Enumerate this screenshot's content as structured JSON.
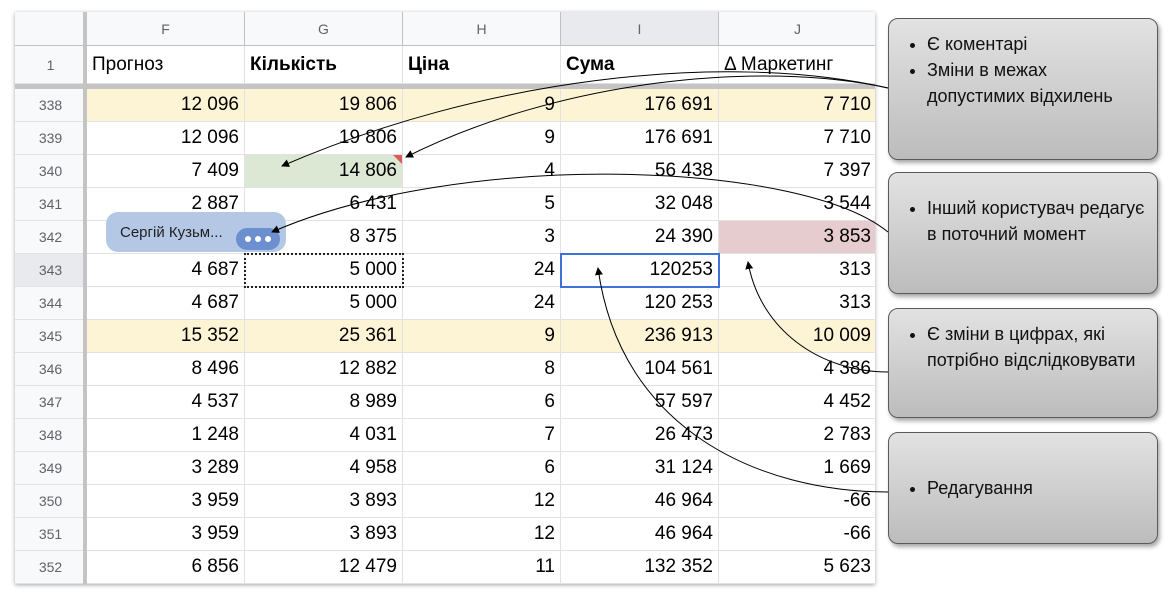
{
  "sheet": {
    "columns": [
      "F",
      "G",
      "H",
      "I",
      "J"
    ],
    "header_row": {
      "number": "1",
      "cells": [
        "Прогноз",
        "Кількість",
        "Ціна",
        "Сума",
        "Δ Маркетинг"
      ]
    },
    "rows": [
      {
        "n": "338",
        "cells": [
          "12 096",
          "19 806",
          "9",
          "176 691",
          "7 710"
        ]
      },
      {
        "n": "339",
        "cells": [
          "12 096",
          "19 806",
          "9",
          "176 691",
          "7 710"
        ]
      },
      {
        "n": "340",
        "cells": [
          "7 409",
          "14 806",
          "4",
          "56 438",
          "7 397"
        ]
      },
      {
        "n": "341",
        "cells": [
          "2 887",
          "6 431",
          "5",
          "32 048",
          "3 544"
        ]
      },
      {
        "n": "342",
        "cells": [
          "",
          "8 375",
          "3",
          "24 390",
          "3 853"
        ]
      },
      {
        "n": "343",
        "cells": [
          "4 687",
          "5 000",
          "24",
          "120253",
          "313"
        ]
      },
      {
        "n": "344",
        "cells": [
          "4 687",
          "5 000",
          "24",
          "120 253",
          "313"
        ]
      },
      {
        "n": "345",
        "cells": [
          "15 352",
          "25 361",
          "9",
          "236 913",
          "10 009"
        ]
      },
      {
        "n": "346",
        "cells": [
          "8 496",
          "12 882",
          "8",
          "104 561",
          "4 386"
        ]
      },
      {
        "n": "347",
        "cells": [
          "4 537",
          "8 989",
          "6",
          "57 597",
          "4 452"
        ]
      },
      {
        "n": "348",
        "cells": [
          "1 248",
          "4 031",
          "7",
          "26 473",
          "2 783"
        ]
      },
      {
        "n": "349",
        "cells": [
          "3 289",
          "4 958",
          "6",
          "31 124",
          "1 669"
        ]
      },
      {
        "n": "350",
        "cells": [
          "3 959",
          "3 893",
          "12",
          "46 964",
          "-66"
        ]
      },
      {
        "n": "351",
        "cells": [
          "3 959",
          "3 893",
          "12",
          "46 964",
          "-66"
        ]
      },
      {
        "n": "352",
        "cells": [
          "6 856",
          "12 479",
          "11",
          "132 352",
          "5 623"
        ]
      }
    ],
    "user_chip": "Сергій Кузьм..."
  },
  "callouts": [
    {
      "items": [
        "Є коментарі",
        "Зміни в межах допустимих відхилень"
      ]
    },
    {
      "items": [
        "Інший користувач редагує в поточний момент"
      ]
    },
    {
      "items": [
        "Є зміни в цифрах, які потрібно відслідковувати"
      ]
    },
    {
      "items": [
        "Редагування"
      ]
    }
  ],
  "colors": {
    "yellow": "#fdf4d6",
    "green": "#dde8d4",
    "red": "#e6cccf",
    "active_border": "#3d73d6",
    "chip": "#b4c7e5"
  }
}
